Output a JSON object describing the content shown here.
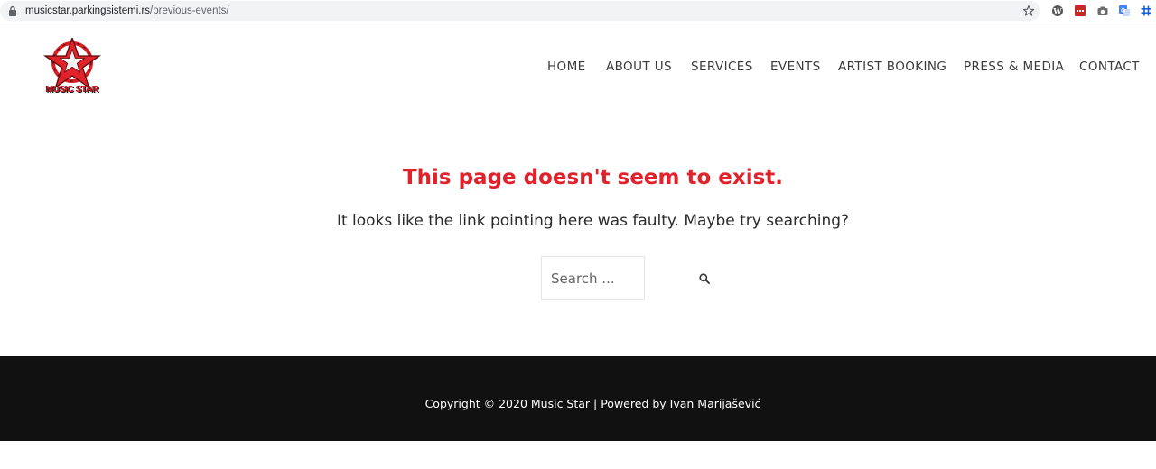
{
  "browser": {
    "url_host": "musicstar.parkingsistemi.rs",
    "url_path": "/previous-events/"
  },
  "header": {
    "logo_text": "MUSIC STAR",
    "nav": [
      "HOME",
      "ABOUT US",
      "SERVICES",
      "EVENTS",
      "ARTIST BOOKING",
      "PRESS & MEDIA",
      "CONTACT"
    ]
  },
  "main": {
    "headline": "This page doesn't seem to exist.",
    "subline": "It looks like the link pointing here was faulty. Maybe try searching?",
    "search_placeholder": "Search ..."
  },
  "footer": {
    "text": "Copyright © 2020 Music Star | Powered by Ivan Marijašević"
  },
  "colors": {
    "accent_red": "#e0222b",
    "footer_bg": "#111111"
  },
  "icons": [
    "lock-icon",
    "star-icon",
    "wordpress-icon",
    "extension-icon",
    "camera-icon",
    "translate-icon",
    "hashtag-icon",
    "search-icon"
  ]
}
